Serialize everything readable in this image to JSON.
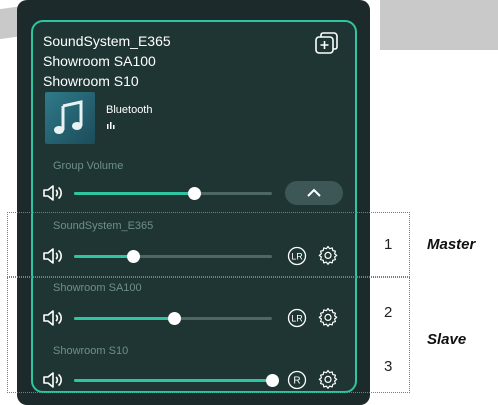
{
  "group": {
    "names": [
      "SoundSystem_E365",
      "Showroom SA100",
      "Showroom S10"
    ],
    "source": "Bluetooth",
    "volume_label": "Group Volume",
    "volume": 0.61
  },
  "speakers": [
    {
      "name": "SoundSystem_E365",
      "volume": 0.3,
      "channel": "LR"
    },
    {
      "name": "Showroom SA100",
      "volume": 0.51,
      "channel": "LR"
    },
    {
      "name": "Showroom S10",
      "volume": 1.0,
      "channel": "R"
    }
  ],
  "annotations": {
    "numbers": [
      "1",
      "2",
      "3"
    ],
    "master": "Master",
    "slave": "Slave",
    "highlight_color": "#e05050"
  },
  "colors": {
    "accent": "#2ec6a0",
    "panel": "#1f3534",
    "track": "#4d6763"
  }
}
